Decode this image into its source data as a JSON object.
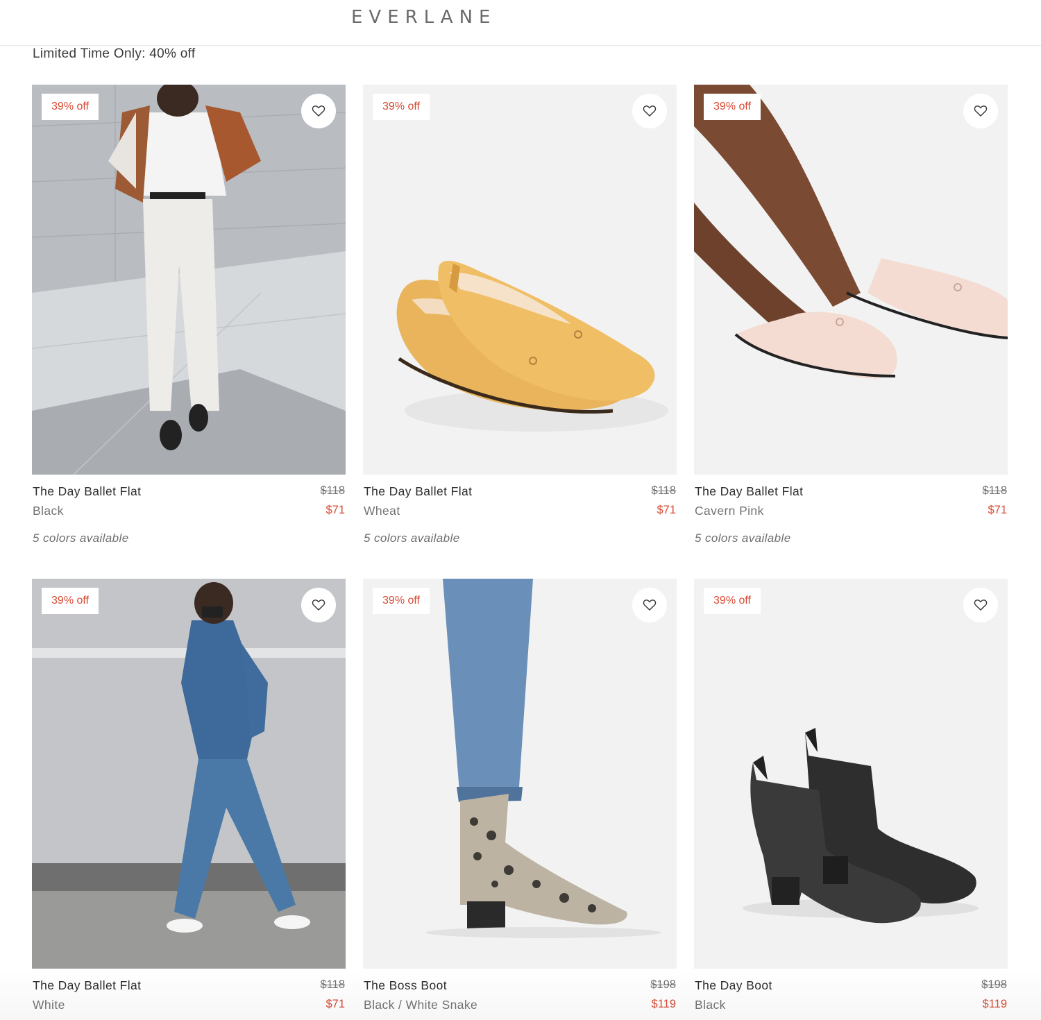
{
  "header": {
    "logo": "EVERLANE"
  },
  "promo": {
    "text": "Limited Time Only: 40% off"
  },
  "products": [
    {
      "badge": "39% off",
      "name": "The Day Ballet Flat",
      "color": "Black",
      "original_price": "$118",
      "sale_price": "$71",
      "colors_available": "5 colors available"
    },
    {
      "badge": "39% off",
      "name": "The Day Ballet Flat",
      "color": "Wheat",
      "original_price": "$118",
      "sale_price": "$71",
      "colors_available": "5 colors available"
    },
    {
      "badge": "39% off",
      "name": "The Day Ballet Flat",
      "color": "Cavern Pink",
      "original_price": "$118",
      "sale_price": "$71",
      "colors_available": "5 colors available"
    },
    {
      "badge": "39% off",
      "name": "The Day Ballet Flat",
      "color": "White",
      "original_price": "$118",
      "sale_price": "$71"
    },
    {
      "badge": "39% off",
      "name": "The Boss Boot",
      "color": "Black / White Snake",
      "original_price": "$198",
      "sale_price": "$119"
    },
    {
      "badge": "39% off",
      "name": "The Day Boot",
      "color": "Black",
      "original_price": "$198",
      "sale_price": "$119"
    }
  ],
  "colors": {
    "sale": "#d84a33",
    "text": "#2d2d2d",
    "muted": "#737373"
  },
  "icons": {
    "favorite": "heart-outline-icon"
  }
}
